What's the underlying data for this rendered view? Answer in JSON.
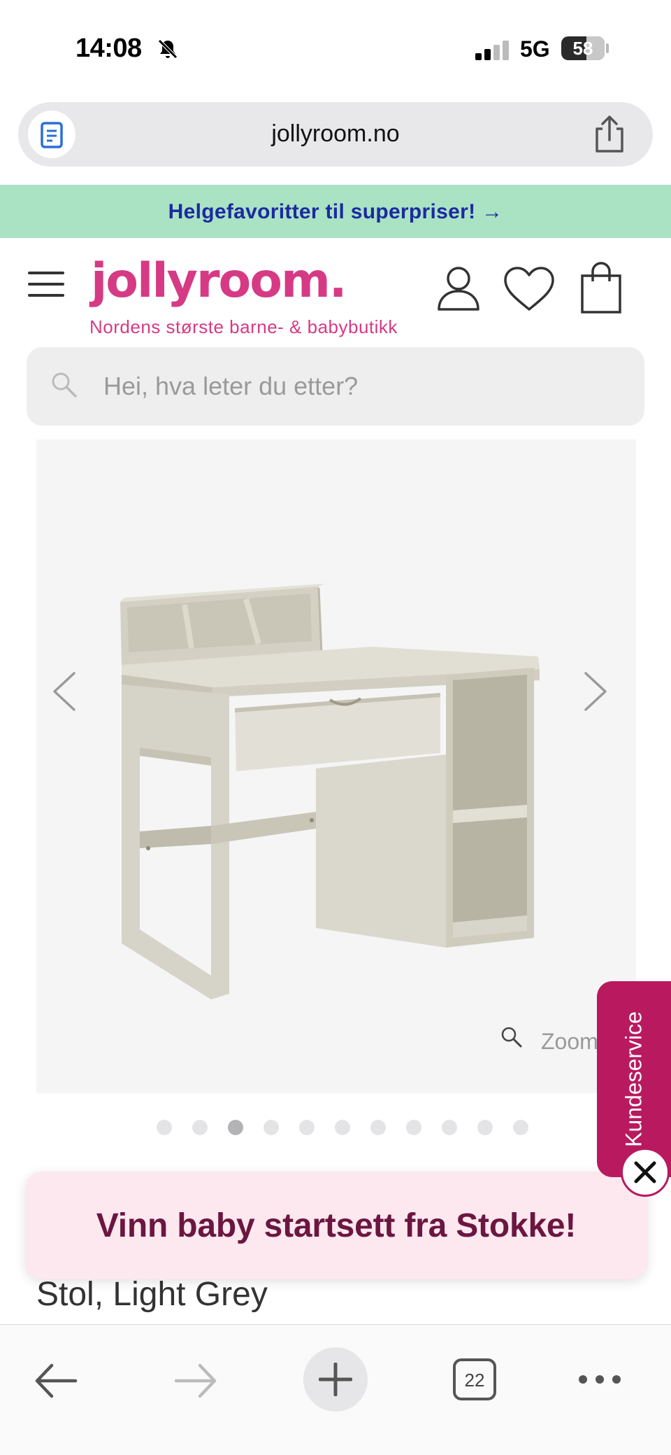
{
  "status_bar": {
    "time": "14:08",
    "network": "5G",
    "battery": "58",
    "battery_level": 0.58,
    "icons": [
      "bell-slash-icon",
      "signal-icon",
      "battery-icon"
    ]
  },
  "browser": {
    "url": "jollyroom.no",
    "icons": [
      "reader-mode-icon",
      "share-icon"
    ]
  },
  "promo": {
    "text": "Helgefavoritter til superpriser! →"
  },
  "header": {
    "logo": "jollyroom.",
    "tagline": "Nordens største barne- & babybutikk",
    "icons": [
      "menu-icon",
      "account-icon",
      "heart-icon",
      "cart-icon"
    ]
  },
  "search": {
    "placeholder": "Hei, hva leter du etter?"
  },
  "gallery": {
    "zoom_label": "Zoom",
    "dot_count": 11,
    "active_dot": 3
  },
  "customer_service": {
    "label": "Kundeservice"
  },
  "popup": {
    "text": "Vinn baby startsett fra Stokke!"
  },
  "product": {
    "title_visible": "Stol, Light Grey"
  },
  "toolbar": {
    "tabs_count": "22",
    "icons": [
      "back-arrow-icon",
      "forward-arrow-icon",
      "plus-icon",
      "tabs-icon",
      "more-icon"
    ]
  },
  "colors": {
    "brand_pink": "#d63a84",
    "promo_green": "#a9e3c3",
    "promo_text_blue": "#1c2aa0",
    "service_magenta": "#b8195f",
    "popup_bg": "#fce8ee",
    "popup_text": "#6b1640"
  }
}
